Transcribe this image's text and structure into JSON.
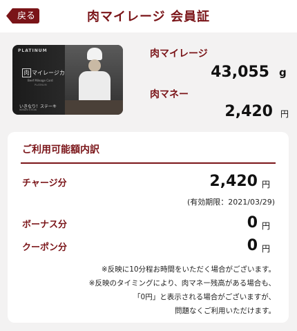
{
  "header": {
    "back_label": "戻る",
    "title": "肉マイレージ 会員証"
  },
  "card": {
    "platinum": "PLATINUM",
    "logo_box": "肉",
    "logo_text": "マイレージカード",
    "sub1": "Beef Mileage Card",
    "sub2": "PLATINUM",
    "brand": "いきなり！ステーキ",
    "brand2": "IKINARI STEAK"
  },
  "summary": {
    "mileage_label": "肉マイレージ",
    "mileage_value": "43,055",
    "mileage_unit": "g",
    "money_label": "肉マネー",
    "money_value": "2,420",
    "money_unit": "円"
  },
  "breakdown": {
    "title": "ご利用可能額内訳",
    "charge_label": "チャージ分",
    "charge_value": "2,420",
    "charge_unit": "円",
    "expiry": "(有効期限：2021/03/29)",
    "bonus_label": "ボーナス分",
    "bonus_value": "0",
    "bonus_unit": "円",
    "coupon_label": "クーポン分",
    "coupon_value": "0",
    "coupon_unit": "円",
    "notes": [
      "※反映に10分程お時間をいただく場合がございます。",
      "※反映のタイミングにより、肉マネー残高がある場合も、",
      "「0円」と表示される場合がございますが、",
      "問題なくご利用いただけます。"
    ]
  },
  "colors": {
    "accent": "#7a1418",
    "background": "#f3f2f2",
    "panel": "#ffffff"
  }
}
